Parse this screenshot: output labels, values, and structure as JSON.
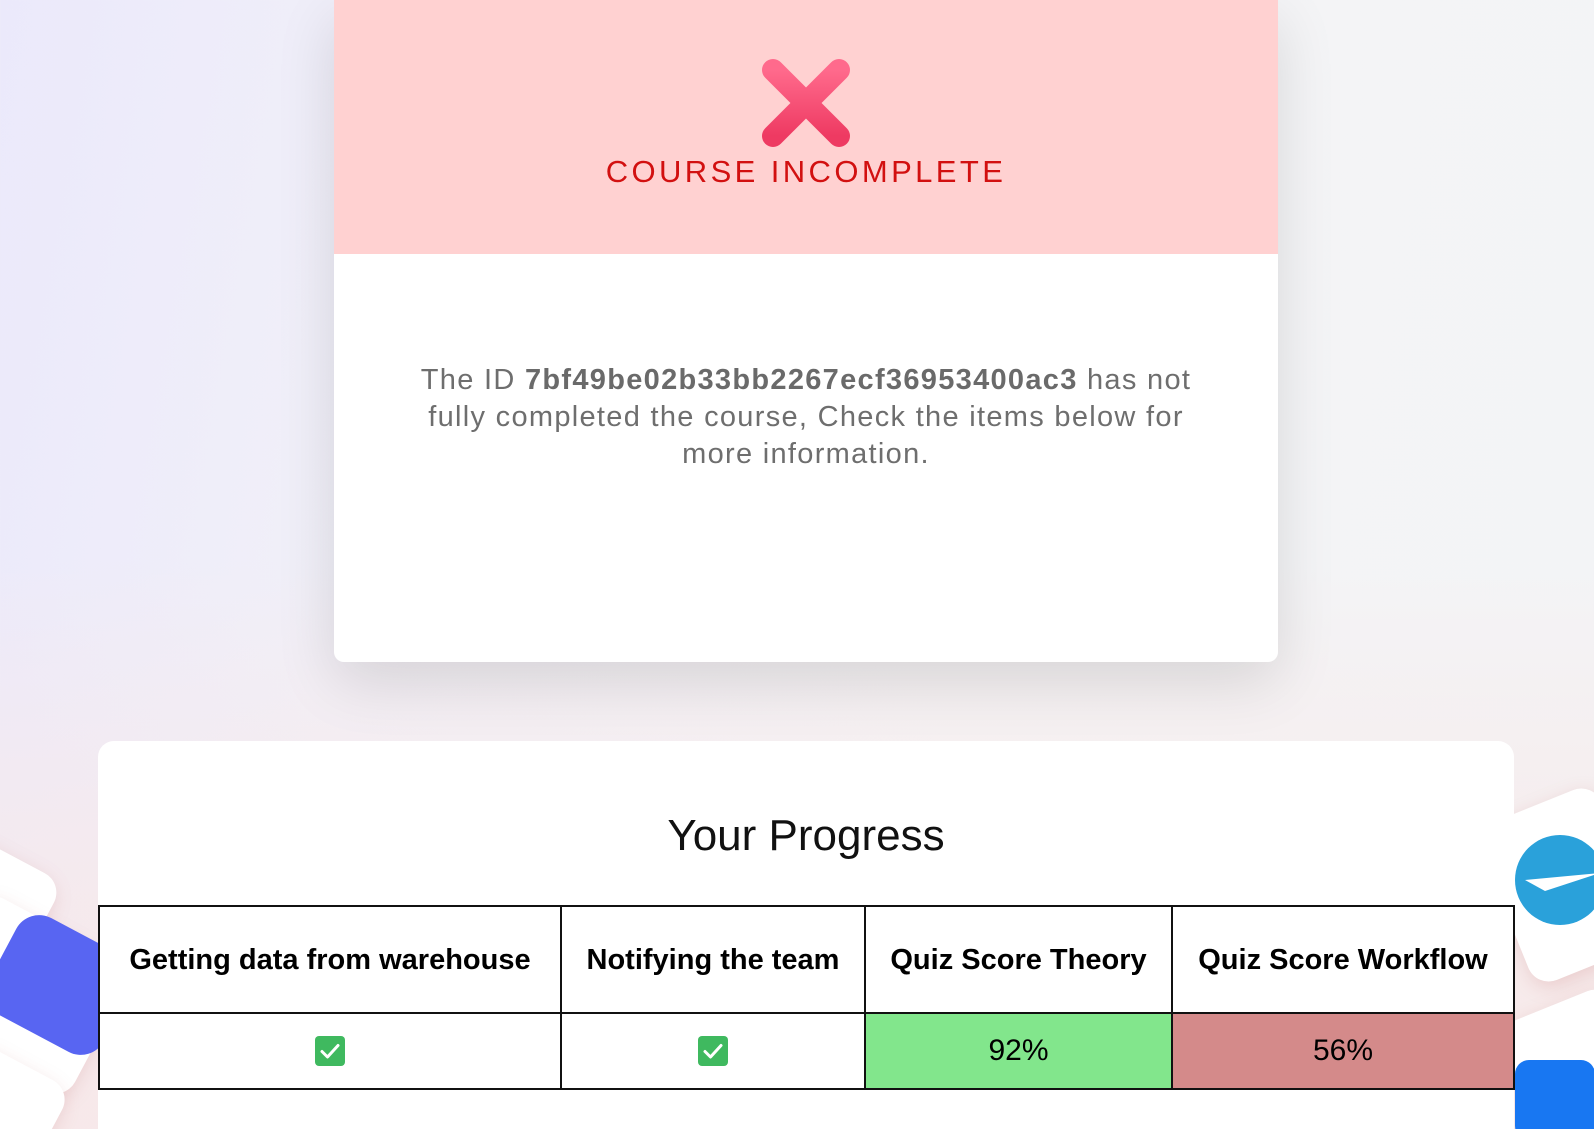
{
  "status": {
    "icon": "x-icon",
    "title": "COURSE INCOMPLETE",
    "message_prefix": "The ID ",
    "id": "7bf49be02b33bb2267ecf36953400ac3",
    "message_suffix": " has not fully completed the course, Check the items below for more information.",
    "banner_color": "#ffd1d1",
    "title_color": "#d21010",
    "icon_color": "#f24a72"
  },
  "progress": {
    "title": "Your Progress",
    "columns": [
      "Getting data from warehouse",
      "Notifying the team",
      "Quiz Score Theory",
      "Quiz Score Workflow"
    ],
    "row": [
      {
        "type": "check",
        "icon": "check-mark-icon",
        "done": true
      },
      {
        "type": "check",
        "icon": "check-mark-icon",
        "done": true
      },
      {
        "type": "score",
        "value": "92%",
        "color": "#82e68c"
      },
      {
        "type": "score",
        "value": "56%",
        "color": "#d48a8a"
      }
    ]
  },
  "background_icons": [
    "discord-icon",
    "telegram-icon",
    "facebook-icon"
  ]
}
